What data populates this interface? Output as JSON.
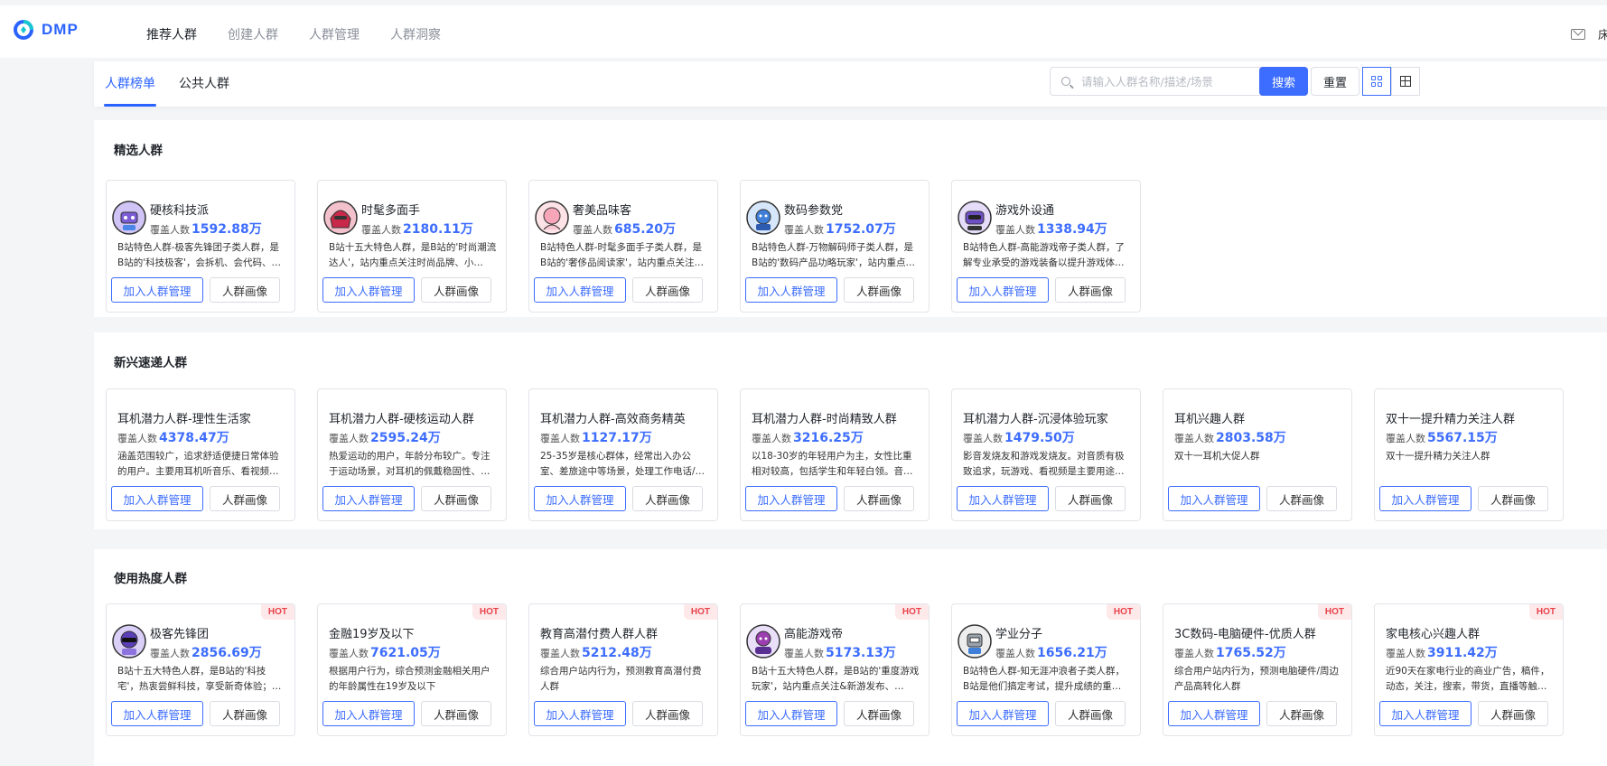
{
  "app": {
    "logo_text": "DMP"
  },
  "nav": [
    {
      "label": "推荐人群",
      "active": true
    },
    {
      "label": "创建人群",
      "active": false
    },
    {
      "label": "人群管理",
      "active": false
    },
    {
      "label": "人群洞察",
      "active": false
    }
  ],
  "header_right": {
    "user_stub": "床"
  },
  "tabs": [
    {
      "label": "人群榜单",
      "active": true
    },
    {
      "label": "公共人群",
      "active": false
    }
  ],
  "search": {
    "placeholder": "请输入人群名称/描述/场景",
    "value": "",
    "search_label": "搜索",
    "reset_label": "重置"
  },
  "colors": {
    "accent": "#3d6dfe",
    "hot_bg": "#fde9ea",
    "hot_text": "#e8434b"
  },
  "count_label": "覆盖人数",
  "add_label": "加入人群管理",
  "portrait_label": "人群画像",
  "hot_label": "HOT",
  "sections": [
    {
      "title": "精选人群",
      "cards": [
        {
          "name": "硬核科技派",
          "count": "1592.88万",
          "avatar": "purple-robot",
          "desc": "B站特色人群-极客先锋团子类人群，是B站的'科技极客'，会拆机、会代码、…"
        },
        {
          "name": "时髦多面手",
          "count": "2180.11万",
          "avatar": "red-fashion",
          "desc": "B站十五大特色人群，是B站的'时尚潮流达人'，站内重点关注时尚品牌、小…"
        },
        {
          "name": "奢美品味客",
          "count": "685.20万",
          "avatar": "pink-luxury",
          "desc": "B站特色人群-时髦多面手子类人群，是B站的'奢侈品阅读家'，站内重点关注…"
        },
        {
          "name": "数码参数党",
          "count": "1752.07万",
          "avatar": "blue-digital",
          "desc": "B站特色人群-万物解码师子类人群，是B站的'数码产品功略玩家'，站内重点…"
        },
        {
          "name": "游戏外设通",
          "count": "1338.94万",
          "avatar": "purple-gamer",
          "desc": "B站特色人群-高能游戏帝子类人群，了解专业承受的游戏装备以提升游戏体…"
        }
      ]
    },
    {
      "title": "新兴速递人群",
      "cards": [
        {
          "name": "耳机潜力人群-理性生活家",
          "count": "4378.47万",
          "avatar": "",
          "desc": "涵盖范围较广，追求舒适便捷日常体验的用户。主要用耳机听音乐、看视频…"
        },
        {
          "name": "耳机潜力人群-硬核运动人群",
          "count": "2595.24万",
          "avatar": "",
          "desc": "热爱运动的用户，年龄分布较广。专注于运动场景，对耳机的佩戴稳固性、…"
        },
        {
          "name": "耳机潜力人群-高效商务精英",
          "count": "1127.17万",
          "avatar": "",
          "desc": "25-35岁是核心群体，经常出入办公室、差旅途中等场景，处理工作电话/…"
        },
        {
          "name": "耳机潜力人群-时尚精致人群",
          "count": "3216.25万",
          "avatar": "",
          "desc": "以18-30岁的年轻用户为主，女性比重相对较高，包括学生和年轻白领。音…"
        },
        {
          "name": "耳机潜力人群-沉浸体验玩家",
          "count": "1479.50万",
          "avatar": "",
          "desc": "影音发烧友和游戏发烧友。对音质有极致追求，玩游戏、看视频是主要用途…"
        },
        {
          "name": "耳机兴趣人群",
          "count": "2803.58万",
          "avatar": "",
          "desc": "双十一耳机大促人群"
        },
        {
          "name": "双十一提升精力关注人群",
          "count": "5567.15万",
          "avatar": "",
          "desc": "双十一提升精力关注人群"
        }
      ]
    },
    {
      "title": "使用热度人群",
      "cards": [
        {
          "name": "极客先锋团",
          "count": "2856.69万",
          "avatar": "purple-geek",
          "hot": true,
          "desc": "B站十五大特色人群，是B站的'科技宅'，热衷尝鲜科技，享受新奇体验；…"
        },
        {
          "name": "金融19岁及以下",
          "count": "7621.05万",
          "avatar": "",
          "hot": true,
          "desc": "根据用户行为，综合预测金融相关用户的年龄属性在19岁及以下"
        },
        {
          "name": "教育高潜付费人群人群",
          "count": "5212.48万",
          "avatar": "",
          "hot": true,
          "desc": "综合用户站内行为，预测教育高潜付费人群"
        },
        {
          "name": "高能游戏帝",
          "count": "5173.13万",
          "avatar": "purple-gamer2",
          "hot": true,
          "desc": "B站十五大特色人群，是B站的'重度游戏玩家'，站内重点关注&新游发布、…"
        },
        {
          "name": "学业分子",
          "count": "1656.21万",
          "avatar": "grey-student",
          "hot": true,
          "desc": "B站特色人群-知无涯冲浪者子类人群，B站是他们搞定考试，提升成绩的重…"
        },
        {
          "name": "3C数码-电脑硬件-优质人群",
          "count": "1765.52万",
          "avatar": "",
          "hot": true,
          "desc": "综合用户站内行为，预测电脑硬件/周边产品高转化人群"
        },
        {
          "name": "家电核心兴趣人群",
          "count": "3911.42万",
          "avatar": "",
          "hot": true,
          "desc": "近90天在家电行业的商业广告，稿件，动态，关注，搜索，带货，直播等触…"
        }
      ]
    }
  ]
}
